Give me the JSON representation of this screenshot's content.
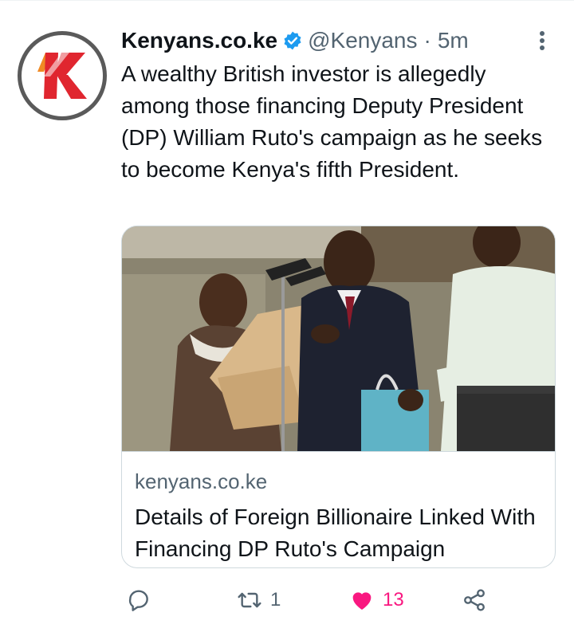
{
  "tweet": {
    "author_name": "Kenyans.co.ke",
    "handle": "@Kenyans",
    "separator": "·",
    "time": "5m",
    "text": "A wealthy British investor is allegedly among those financing Deputy President (DP) William Ruto's campaign as he seeks to become Kenya's fifth President.",
    "avatar_icon": "kenyans-logo-icon",
    "verified_icon": "verified-badge-icon",
    "more_icon": "more-options-icon"
  },
  "card": {
    "domain": "kenyans.co.ke",
    "title": "Details of Foreign Billionaire Linked With Financing DP Ruto's Campaign"
  },
  "actions": {
    "reply_count": "",
    "retweet_count": "1",
    "like_count": "13",
    "share_count": ""
  },
  "colors": {
    "verified": "#1d9bf0",
    "like": "#f91880",
    "secondary_text": "#536471",
    "brand_red": "#e0262f",
    "brand_orange": "#f08a24"
  }
}
